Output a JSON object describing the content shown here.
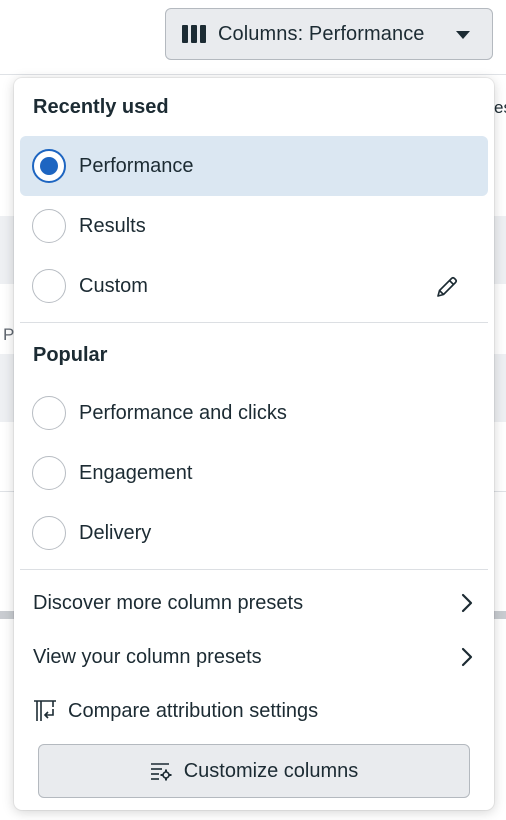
{
  "columns_button": {
    "label": "Columns: Performance",
    "icon": "columns-icon"
  },
  "background": {
    "fragment_left": "P",
    "fragment_right": "es"
  },
  "dropdown": {
    "recently_used": {
      "title": "Recently used",
      "options": [
        {
          "label": "Performance",
          "selected": true
        },
        {
          "label": "Results",
          "selected": false
        },
        {
          "label": "Custom",
          "selected": false,
          "icon": "pencil-edit-icon"
        }
      ]
    },
    "popular": {
      "title": "Popular",
      "options": [
        {
          "label": "Performance and clicks",
          "selected": false
        },
        {
          "label": "Engagement",
          "selected": false
        },
        {
          "label": "Delivery",
          "selected": false
        }
      ]
    },
    "links": {
      "discover": "Discover more column presets",
      "view": "View your column presets",
      "compare": "Compare attribution settings"
    },
    "customize_button": "Customize columns"
  },
  "colors": {
    "accent": "#1d65c1",
    "selected_bg": "#dbe7f2",
    "text": "#1c2b33"
  }
}
